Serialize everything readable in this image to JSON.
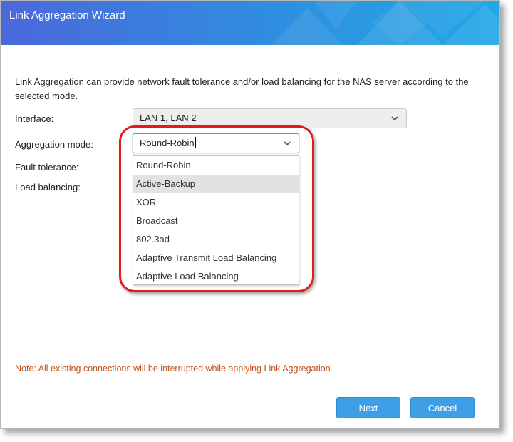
{
  "dialog": {
    "title": "Link Aggregation Wizard",
    "intro": "Link Aggregation can provide network fault tolerance and/or load balancing for the NAS server according to the selected mode."
  },
  "fields": {
    "interface_label": "Interface:",
    "interface_value": "LAN 1, LAN 2",
    "mode_label": "Aggregation mode:",
    "mode_value": "Round-Robin",
    "fault_tolerance_label": "Fault tolerance:",
    "load_balancing_label": "Load balancing:"
  },
  "dropdown": {
    "options": [
      "Round-Robin",
      "Active-Backup",
      "XOR",
      "Broadcast",
      "802.3ad",
      "Adaptive Transmit Load Balancing",
      "Adaptive Load Balancing"
    ],
    "hovered_option": "Active-Backup"
  },
  "note": "Note: All existing connections will be interrupted while applying Link Aggregation.",
  "buttons": {
    "next": "Next",
    "cancel": "Cancel"
  },
  "colors": {
    "title_gradient_start": "#4b68db",
    "title_gradient_end": "#22a8e6",
    "button": "#3f9fe6",
    "note": "#c0531c",
    "highlight_ring": "#e21b1b"
  },
  "icons": {
    "interface_dropdown": "chevron-down-icon",
    "mode_dropdown": "chevron-down-icon"
  }
}
